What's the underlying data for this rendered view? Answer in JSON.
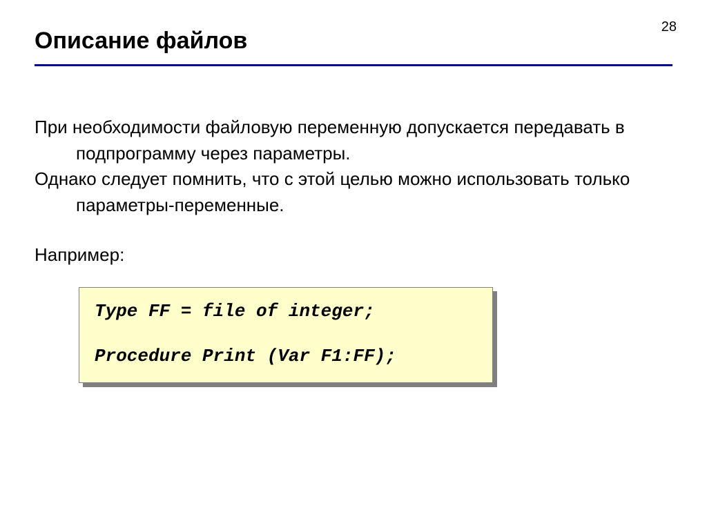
{
  "page_number": "28",
  "title": "Описание файлов",
  "body": {
    "p1": "При необходимости файловую переменную допускается передавать в подпрограмму через параметры.",
    "p2": "Однако следует помнить, что с этой целью можно использовать только параметры-переменные.",
    "example_label": "Например:"
  },
  "code": {
    "line1": "Type FF = file of integer;",
    "line2": "Procedure Print (Var F1:FF);"
  }
}
